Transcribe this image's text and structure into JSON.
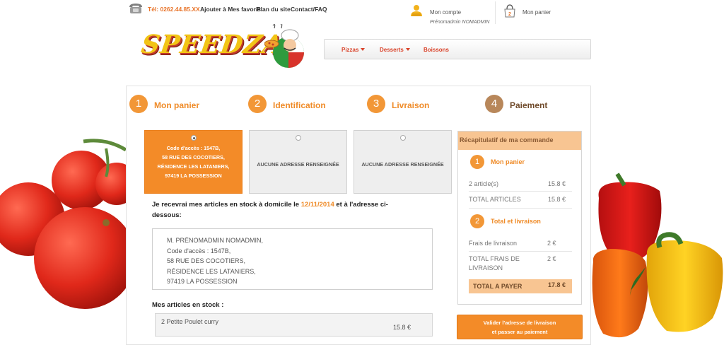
{
  "topbar": {
    "phone": "Tél: 0262.44.85.XX",
    "links": [
      "Ajouter à Mes favoris",
      "Plan du site",
      "Contact/FAQ"
    ],
    "account_label": "Mon compte",
    "account_user": "Prénomadmin NOMADMIN",
    "cart_label": "Mon panier",
    "cart_count": "2"
  },
  "logo": {
    "text": "SPEEDZA"
  },
  "nav": {
    "items": [
      "Pizzas",
      "Desserts",
      "Boissons"
    ]
  },
  "steps": [
    {
      "num": "1",
      "label": "Mon panier"
    },
    {
      "num": "2",
      "label": "Identification"
    },
    {
      "num": "3",
      "label": "Livraison"
    },
    {
      "num": "4",
      "label": "Paiement"
    }
  ],
  "address_cards": [
    {
      "lines": [
        "Code d'accès : 1547B,",
        "58 RUE DES COCOTIERS,",
        "RÉSIDENCE LES LATANIERS,",
        "97419 LA POSSESSION"
      ],
      "selected": true
    },
    {
      "lines": [
        "AUCUNE ADRESSE RENSEIGNÉE"
      ],
      "selected": false
    },
    {
      "lines": [
        "AUCUNE ADRESSE RENSEIGNÉE"
      ],
      "selected": false
    }
  ],
  "delivery": {
    "text_before": "Je recevrai mes articles en stock à domicile le ",
    "date": "12/11/2014",
    "text_after": " et à l'adresse ci-dessous:"
  },
  "address_block": [
    "M. PRÉNOMADMIN NOMADMIN,",
    "Code d'accès : 1547B,",
    "58 RUE DES COCOTIERS,",
    "RÉSIDENCE LES LATANIERS,",
    "97419 LA POSSESSION"
  ],
  "stock": {
    "title": "Mes articles en stock :",
    "items": [
      {
        "name": "2 Petite Poulet curry",
        "price": "15.8 €"
      }
    ]
  },
  "summary": {
    "title": "Récapitulatif de ma commande",
    "section1": {
      "num": "1",
      "title": "Mon panier"
    },
    "articles_label": "2 article(s)",
    "articles_value": "15.8 €",
    "total_articles_label": "TOTAL ARTICLES",
    "total_articles_value": "15.8 €",
    "section2": {
      "num": "2",
      "title": "Total et livraison"
    },
    "fees_label": "Frais de livraison",
    "fees_value": "2 €",
    "total_fees_label": "TOTAL FRAIS DE LIVRAISON",
    "total_fees_value": "2 €",
    "grand_label": "TOTAL A PAYER",
    "grand_value": "17.8 €"
  },
  "validate_button": {
    "line1": "Valider l'adresse de livraison",
    "line2": "et passer au paiement"
  },
  "colors": {
    "accent": "#f38b28",
    "accent_light": "#f8c592",
    "red": "#d9432a"
  },
  "icons": [
    "phone-icon",
    "account-icon",
    "cart-icon",
    "chef-icon"
  ]
}
